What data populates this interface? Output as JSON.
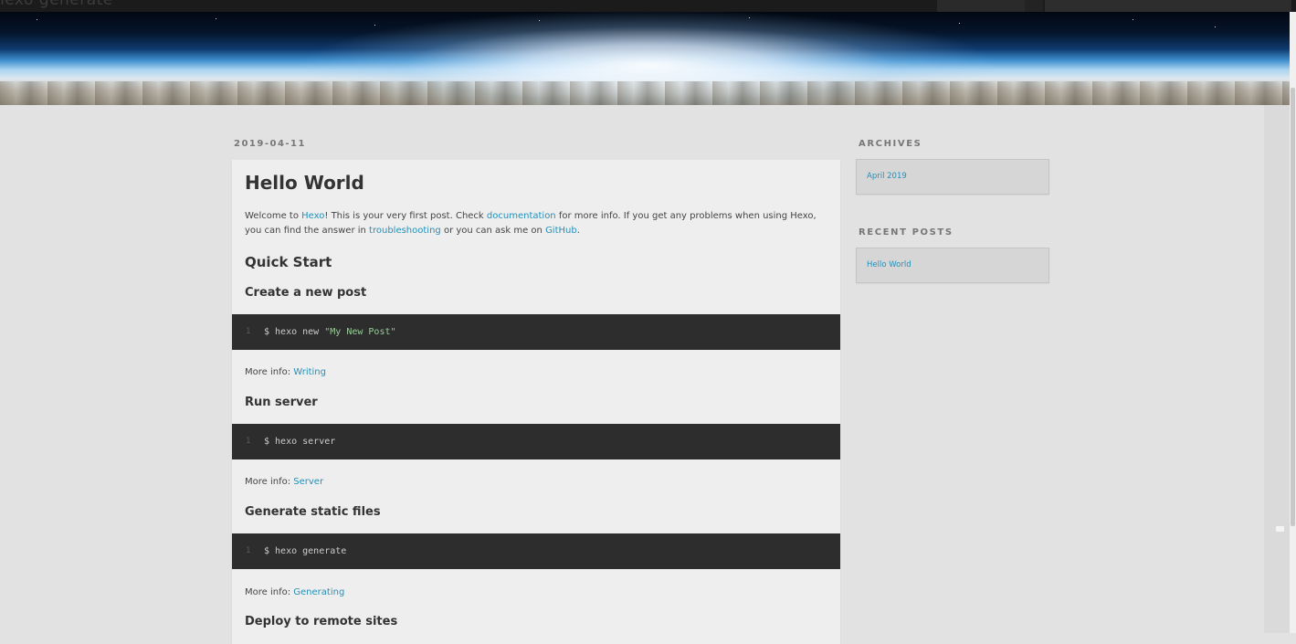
{
  "top_bar": {
    "ghost_title": "hexo generate"
  },
  "post": {
    "date": "2019-04-11",
    "title": "Hello World",
    "intro": {
      "t1": "Welcome to ",
      "link_hexo": "Hexo",
      "t2": "! This is your very first post. Check ",
      "link_docs": "documentation",
      "t3": " for more info. If you get any problems when using Hexo, you can find the answer in ",
      "link_troubleshooting": "troubleshooting",
      "t4": " or you can ask me on ",
      "link_github": "GitHub",
      "t5": "."
    },
    "quick_start": "Quick Start",
    "sections": [
      {
        "heading": "Create a new post",
        "line_no": "1",
        "code_cmd": "$ hexo new ",
        "code_str": "\"My New Post\"",
        "more_prefix": "More info: ",
        "more_link": "Writing"
      },
      {
        "heading": "Run server",
        "line_no": "1",
        "code_cmd": "$ hexo server",
        "code_str": "",
        "more_prefix": "More info: ",
        "more_link": "Server"
      },
      {
        "heading": "Generate static files",
        "line_no": "1",
        "code_cmd": "$ hexo generate",
        "code_str": "",
        "more_prefix": "More info: ",
        "more_link": "Generating"
      },
      {
        "heading": "Deploy to remote sites"
      }
    ]
  },
  "sidebar": {
    "archives_title": "ARCHIVES",
    "archives_link": "April 2019",
    "recent_title": "RECENT POSTS",
    "recent_link": "Hello World"
  },
  "colors": {
    "link": "#258fb8",
    "code_bg": "#2d2d2d",
    "page_bg": "#e2e2e2",
    "card_bg": "#eeeeee"
  }
}
